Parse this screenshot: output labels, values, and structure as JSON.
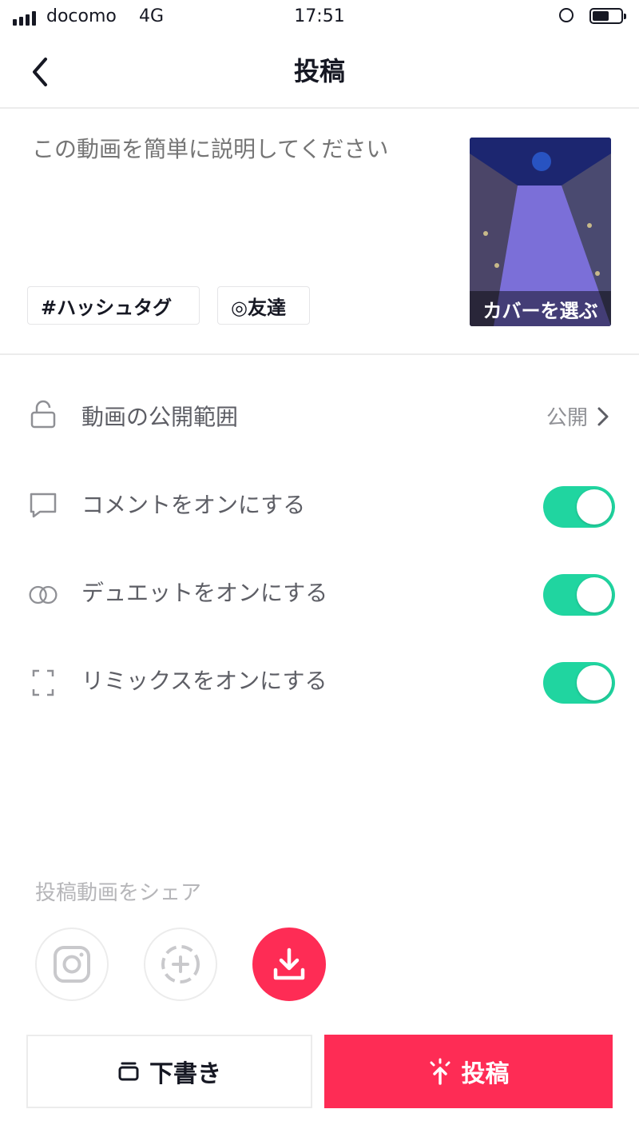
{
  "status_bar": {
    "carrier": "docomo",
    "network": "4G",
    "time": "17:51"
  },
  "nav": {
    "title": "投稿"
  },
  "description": {
    "placeholder": "この動画を簡単に説明してください"
  },
  "chips": {
    "hashtag": "#ハッシュタグ",
    "friends": "◎友達"
  },
  "cover": {
    "label": "カバーを選ぶ"
  },
  "settings": {
    "privacy": {
      "label": "動画の公開範囲",
      "value": "公開"
    },
    "comments": {
      "label": "コメントをオンにする",
      "on": true
    },
    "duet": {
      "label": "デュエットをオンにする",
      "on": true
    },
    "remix": {
      "label": "リミックスをオンにする",
      "on": true
    }
  },
  "share": {
    "title": "投稿動画をシェア",
    "icons": [
      "instagram-icon",
      "add-story-icon",
      "download-icon"
    ]
  },
  "actions": {
    "draft": "下書き",
    "post": "投稿"
  },
  "colors": {
    "accent": "#fe2c55",
    "toggle_on": "#20d5a0"
  }
}
